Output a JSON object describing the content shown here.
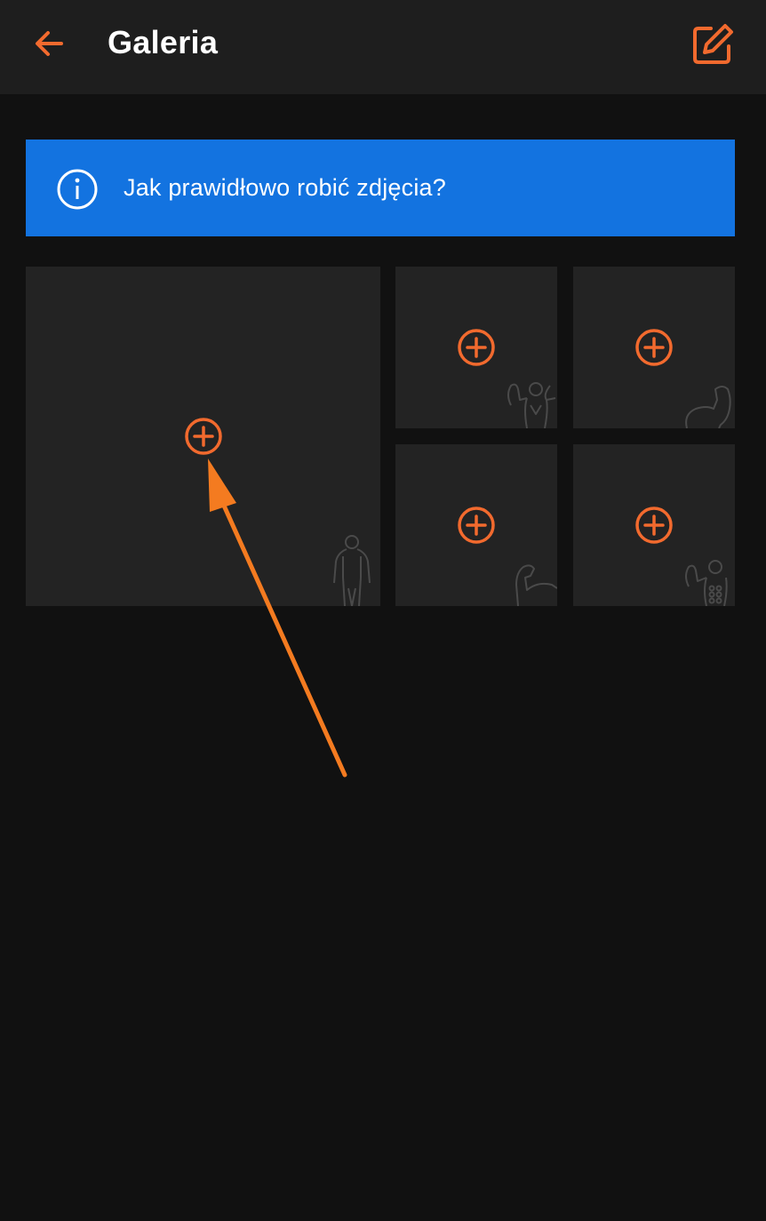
{
  "header": {
    "title": "Galeria",
    "back_icon": "arrow-left-icon",
    "edit_icon": "edit-square-icon"
  },
  "banner": {
    "text": "Jak prawidłowo robić zdjęcia?",
    "icon": "info-circle-icon"
  },
  "gallery": {
    "tiles": [
      {
        "id": "front-body",
        "icon": "add-circle-icon",
        "silhouette": "full-body-front-icon"
      },
      {
        "id": "back-pose",
        "icon": "add-circle-icon",
        "silhouette": "back-double-biceps-icon"
      },
      {
        "id": "side-biceps",
        "icon": "add-circle-icon",
        "silhouette": "flexed-arm-side-icon"
      },
      {
        "id": "arm-flex",
        "icon": "add-circle-icon",
        "silhouette": "flexed-arm-icon"
      },
      {
        "id": "front-abs",
        "icon": "add-circle-icon",
        "silhouette": "front-abs-pose-icon"
      }
    ]
  },
  "colors": {
    "accent": "#f26a2e",
    "banner": "#1373e0",
    "background": "#111111",
    "header": "#1e1e1e",
    "tile": "#232323",
    "annotation_arrow": "#f47b20"
  }
}
